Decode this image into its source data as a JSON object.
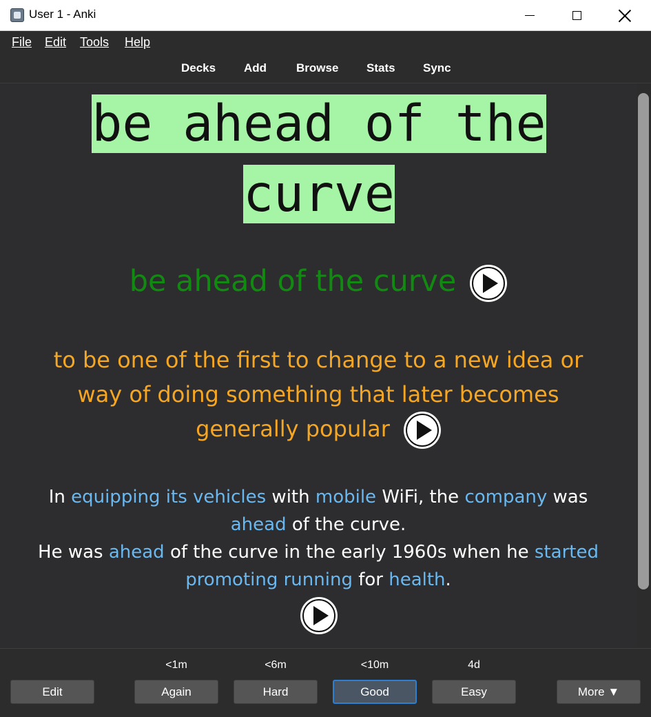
{
  "window": {
    "title": "User 1 - Anki"
  },
  "menu": {
    "file": "File",
    "edit": "Edit",
    "tools": "Tools",
    "help": "Help"
  },
  "toolbar": {
    "decks": "Decks",
    "add": "Add",
    "browse": "Browse",
    "stats": "Stats",
    "sync": "Sync"
  },
  "card": {
    "heading": "be ahead of the curve",
    "term": "be ahead of the curve",
    "definition": "to be one of the first to change to a new idea or way of doing something that later becomes generally popular",
    "examples": {
      "line1": [
        {
          "t": "In ",
          "h": false
        },
        {
          "t": "equipping its vehicles",
          "h": true
        },
        {
          "t": " with ",
          "h": false
        },
        {
          "t": "mobile",
          "h": true
        },
        {
          "t": " WiFi, the ",
          "h": false
        },
        {
          "t": "company",
          "h": true
        },
        {
          "t": " was ",
          "h": false
        },
        {
          "t": "ahead",
          "h": true
        },
        {
          "t": " of the curve.",
          "h": false
        }
      ],
      "line2": [
        {
          "t": "He was ",
          "h": false
        },
        {
          "t": "ahead",
          "h": true
        },
        {
          "t": " of the curve in the early 1960s when he ",
          "h": false
        },
        {
          "t": "started promoting running",
          "h": true
        },
        {
          "t": " for ",
          "h": false
        },
        {
          "t": "health",
          "h": true
        },
        {
          "t": ".",
          "h": false
        }
      ]
    }
  },
  "colors": {
    "heading_bg": "#a6f4a5",
    "term": "#128a12",
    "definition": "#f5a623",
    "highlight": "#6ab8f0"
  },
  "answers": {
    "edit": "Edit",
    "again": {
      "label": "Again",
      "interval": "<1m"
    },
    "hard": {
      "label": "Hard",
      "interval": "<6m"
    },
    "good": {
      "label": "Good",
      "interval": "<10m"
    },
    "easy": {
      "label": "Easy",
      "interval": "4d"
    },
    "more": "More ▼"
  }
}
